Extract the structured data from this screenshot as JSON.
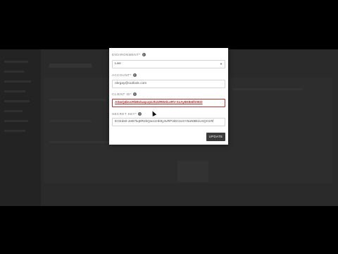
{
  "dialog": {
    "environment": {
      "label": "ENVIRONMENT*",
      "value": "Live",
      "options": [
        "Live"
      ]
    },
    "account": {
      "label": "ACCOUNT*",
      "value": "nkrgay@outlook.com"
    },
    "client_id": {
      "label": "CLIENT ID*",
      "value": "ASwQ4bvcRkBvbaqcqUJh2ZRWdLeRV-XxAy8K8eIlh0KD"
    },
    "secret_key": {
      "label": "SECRET KEY*",
      "value": "EO2ds0-JeB7kq8R2kQwo1Hk9y4vRP2iDr2omY5aN8B1UsQH1Rf"
    },
    "update_label": "UPDATE"
  },
  "icons": {
    "help": "question-circle-icon",
    "dropdown": "chevron-down-icon"
  },
  "colors": {
    "error_border": "#a83a3a",
    "button_bg": "#3b3b3b"
  }
}
